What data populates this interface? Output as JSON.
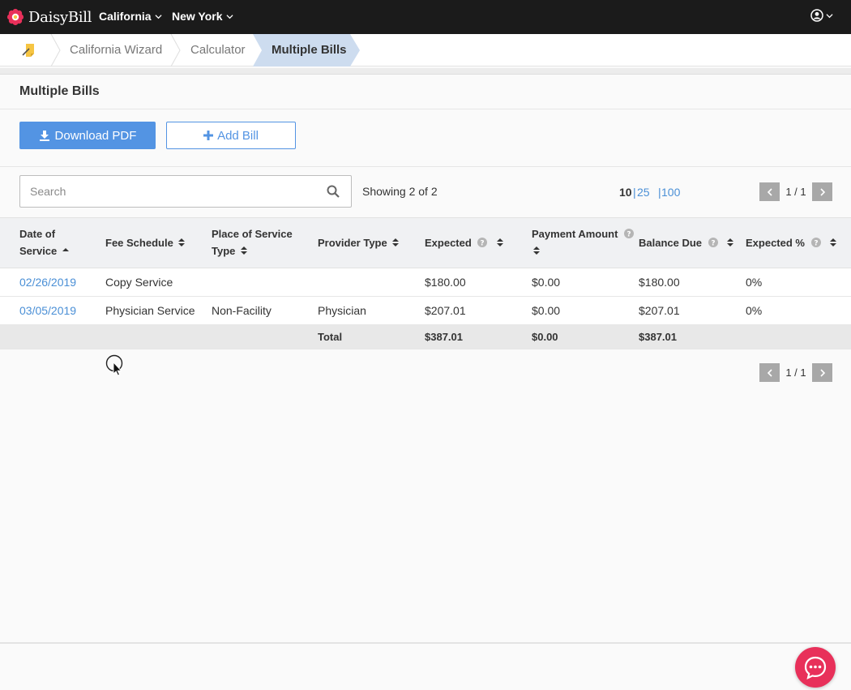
{
  "topnav": {
    "brand": "DaisyBill",
    "menus": [
      {
        "label": "California"
      },
      {
        "label": "New York"
      }
    ],
    "user_icon": "user-circle-icon"
  },
  "breadcrumb": {
    "items": [
      "California Wizard",
      "Calculator",
      "Multiple Bills"
    ]
  },
  "page": {
    "title": "Multiple Bills",
    "download_label": "Download PDF",
    "add_label": "Add Bill"
  },
  "search": {
    "placeholder": "Search",
    "value": ""
  },
  "showing": "Showing 2 of 2",
  "per_page": {
    "options": [
      "10",
      "25",
      "100"
    ],
    "selected": "10"
  },
  "pagination": {
    "top": "1 / 1",
    "bottom": "1 / 1"
  },
  "table": {
    "headers": {
      "date_line1": "Date of",
      "date_line2": "Service",
      "fee_schedule": "Fee Schedule",
      "pos_line1": "Place of Service",
      "pos_line2": "Type",
      "provider_type": "Provider Type",
      "expected": "Expected",
      "payment_amount": "Payment Amount",
      "balance_due": "Balance Due",
      "expected_pct": "Expected %"
    },
    "rows": [
      {
        "date": "02/26/2019",
        "fee_schedule": "Copy Service",
        "pos": "",
        "provider": "",
        "expected": "$180.00",
        "payment": "$0.00",
        "balance": "$180.00",
        "pct": "0%"
      },
      {
        "date": "03/05/2019",
        "fee_schedule": "Physician Service",
        "pos": "Non-Facility",
        "provider": "Physician",
        "expected": "$207.01",
        "payment": "$0.00",
        "balance": "$207.01",
        "pct": "0%"
      }
    ],
    "total": {
      "label": "Total",
      "expected": "$387.01",
      "payment": "$0.00",
      "balance": "$387.01"
    }
  },
  "colors": {
    "accent": "#5394e3",
    "link": "#4a8fd6",
    "nav_bg": "#1b1b1b",
    "chat": "#e8305a"
  }
}
